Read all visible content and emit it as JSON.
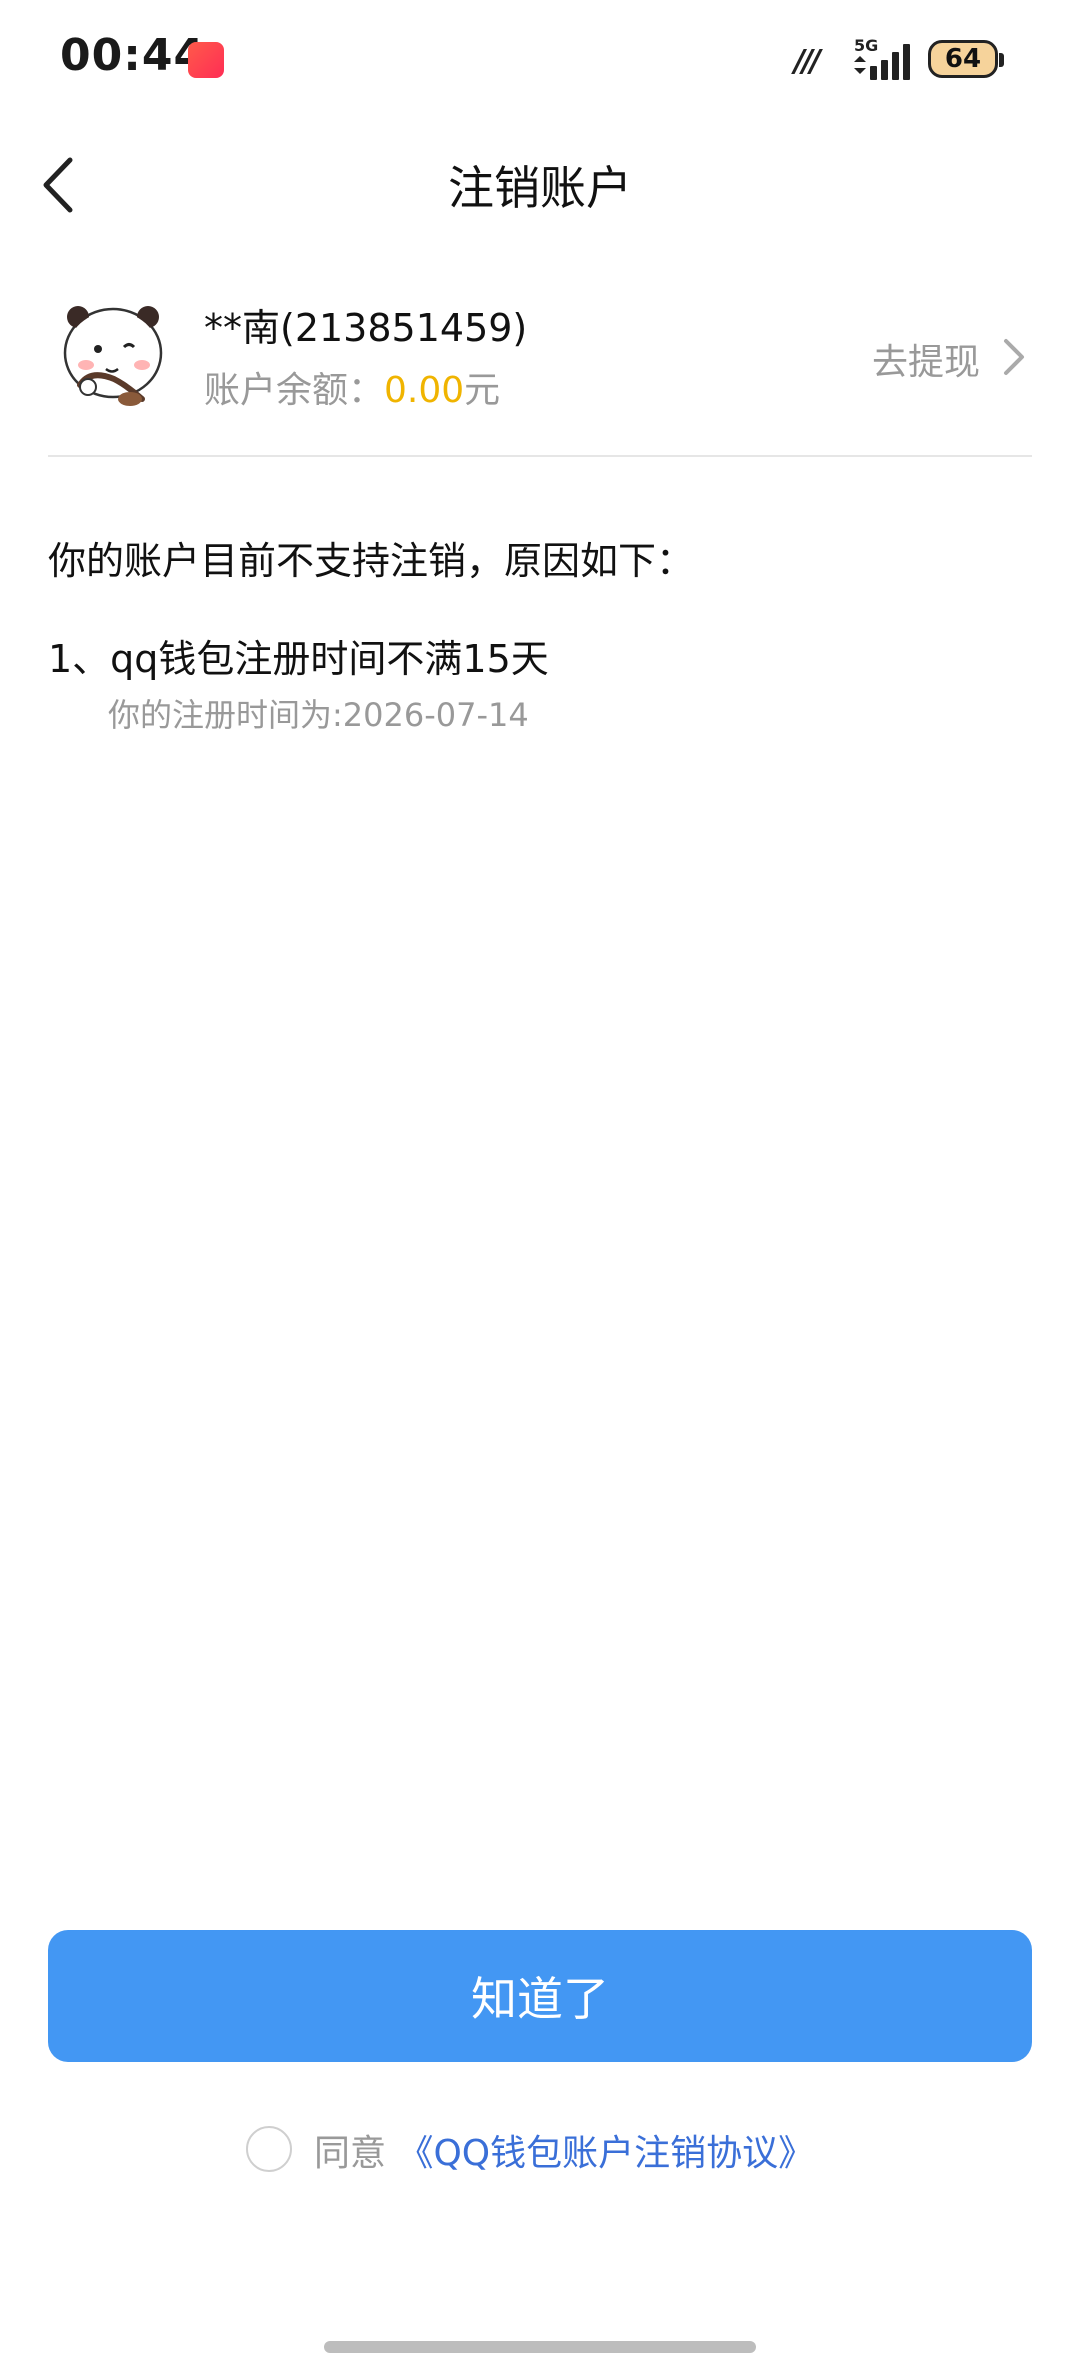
{
  "status_bar": {
    "time": "00:44",
    "network": "5G",
    "battery": "64"
  },
  "nav": {
    "title": "注销账户"
  },
  "account": {
    "name": "**南(213851459)",
    "balance_label": "账户余额：",
    "balance_amount": "0.00",
    "balance_unit": "元",
    "withdraw_label": "去提现"
  },
  "reasons": {
    "heading": "你的账户目前不支持注销，原因如下：",
    "items": [
      {
        "text": "1、qq钱包注册时间不满15天",
        "detail": "你的注册时间为:2026-07-14"
      }
    ]
  },
  "actions": {
    "confirm_label": "知道了",
    "agree_prefix": "同意",
    "agreement_link": "《QQ钱包账户注销协议》"
  },
  "colors": {
    "primary": "#4397f3",
    "amount": "#f0b400",
    "link": "#3a6fd8",
    "muted": "#999999"
  }
}
